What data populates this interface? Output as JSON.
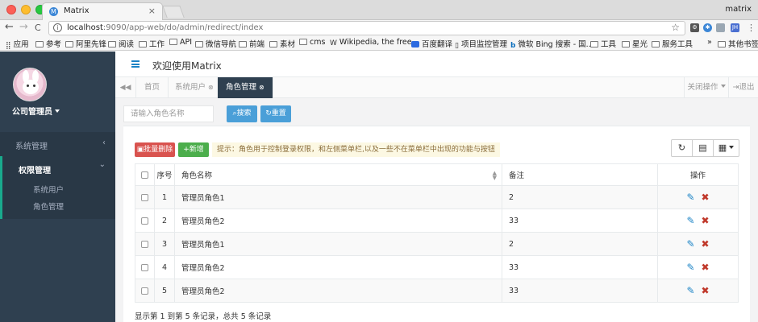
{
  "browser": {
    "tab_title": "Matrix",
    "tab_close": "×",
    "profile": "matrix",
    "nav_back": "←",
    "nav_forward": "→",
    "nav_reload": "C",
    "url_host": "localhost",
    "url_rest": ":9090/app-web/do/admin/redirect/index",
    "star": "☆",
    "menu": "⋮",
    "bookmarks": [
      "应用",
      "参考",
      "阿里先锋",
      "阅读",
      "工作",
      "API",
      "微信导航",
      "前端",
      "素材",
      "cms",
      "Wikipedia, the free...",
      "百度翻译",
      "项目监控管理",
      "微软 Bing 搜索 - 国...",
      "工具",
      "星光",
      "服务工具"
    ],
    "bookmarks_more": "»",
    "other_bookmarks": "其他书签"
  },
  "sidebar": {
    "user_name": "公司管理员",
    "menu": [
      {
        "label": "系统管理",
        "arrow": "‹"
      },
      {
        "label": "权限管理",
        "arrow": "⌄"
      }
    ],
    "submenu": [
      "系统用户",
      "角色管理"
    ]
  },
  "header": {
    "welcome": "欢迎使用Matrix"
  },
  "tabs": {
    "prev": "◀◀",
    "items": [
      {
        "label": "首页"
      },
      {
        "label": "系统用户",
        "close": "⊗"
      },
      {
        "label": "角色管理",
        "close": "⊗"
      }
    ],
    "close_ops": "关闭操作",
    "logout": "退出"
  },
  "search": {
    "placeholder": "请输入角色名称",
    "search_label": "搜索",
    "reset_label": "重置"
  },
  "actions": {
    "batch_delete": "批量删除",
    "add": "新增",
    "hint": "提示：角色用于控制登录权限，和左侧菜单栏,以及一些不在菜单栏中出现的功能与按钮"
  },
  "table": {
    "headers": {
      "seq": "序号",
      "name": "角色名称",
      "remark": "备注",
      "op": "操作"
    },
    "rows": [
      {
        "seq": "1",
        "name": "管理员角色1",
        "remark": "2"
      },
      {
        "seq": "2",
        "name": "管理员角色2",
        "remark": "33"
      },
      {
        "seq": "3",
        "name": "管理员角色1",
        "remark": "2"
      },
      {
        "seq": "4",
        "name": "管理员角色2",
        "remark": "33"
      },
      {
        "seq": "5",
        "name": "管理员角色2",
        "remark": "33"
      }
    ]
  },
  "pagination": {
    "info": "显示第 1 到第 5 条记录，总共 5 条记录"
  },
  "colors": {
    "sidebar_bg": "#2f4050",
    "accent": "#19aa8d",
    "primary": "#1c84c6",
    "danger": "#d9534f",
    "success": "#4cae4c"
  }
}
